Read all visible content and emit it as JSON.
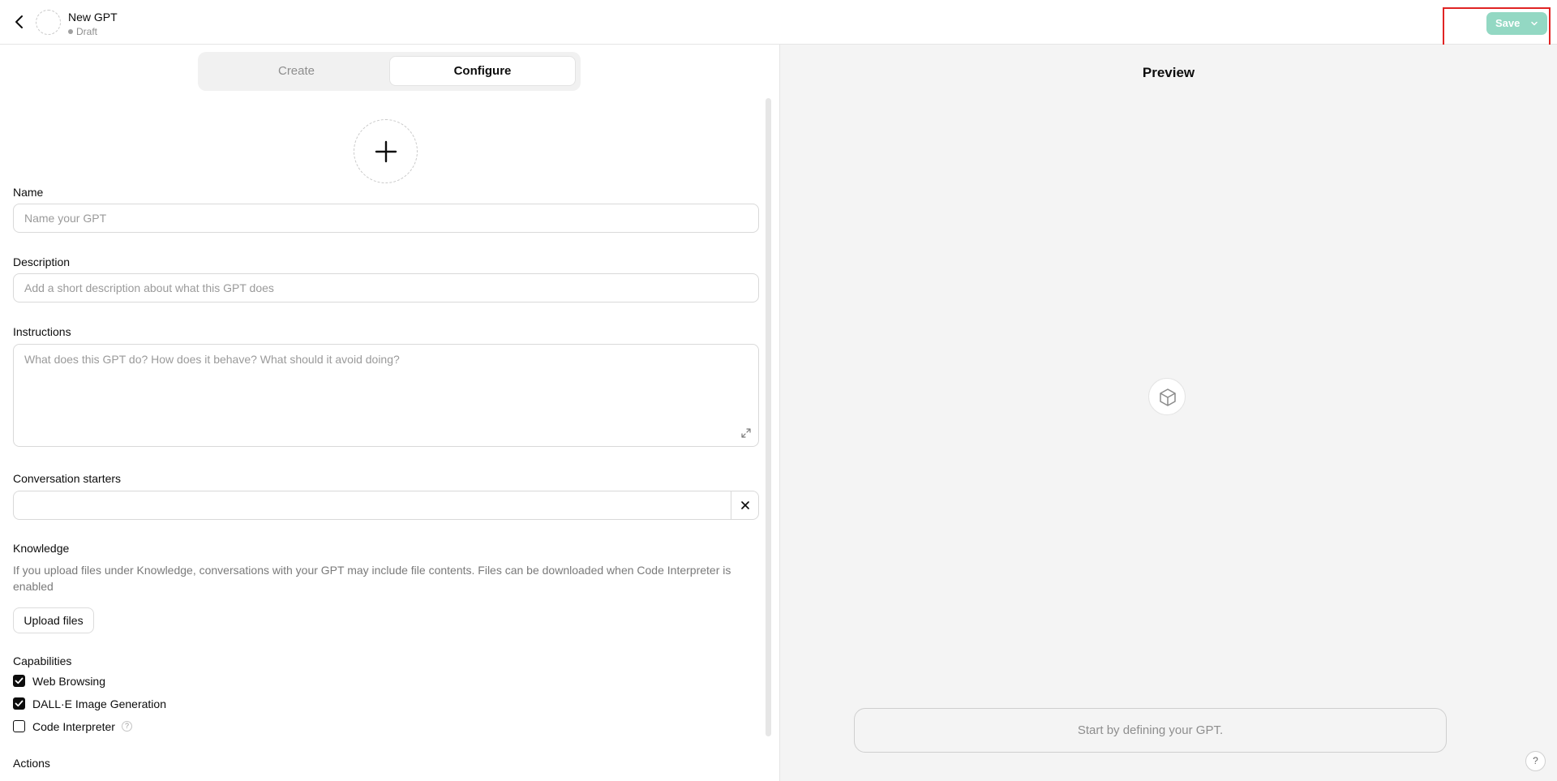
{
  "header": {
    "title": "New GPT",
    "status": "Draft",
    "save_label": "Save"
  },
  "tabs": [
    {
      "label": "Create",
      "active": false
    },
    {
      "label": "Configure",
      "active": true
    }
  ],
  "form": {
    "name": {
      "label": "Name",
      "placeholder": "Name your GPT",
      "value": ""
    },
    "description": {
      "label": "Description",
      "placeholder": "Add a short description about what this GPT does",
      "value": ""
    },
    "instructions": {
      "label": "Instructions",
      "placeholder": "What does this GPT do? How does it behave? What should it avoid doing?",
      "value": ""
    },
    "conversation_starters": {
      "label": "Conversation starters",
      "value": ""
    },
    "knowledge": {
      "label": "Knowledge",
      "description": "If you upload files under Knowledge, conversations with your GPT may include file contents. Files can be downloaded when Code Interpreter is enabled",
      "upload_label": "Upload files"
    },
    "capabilities": {
      "label": "Capabilities",
      "items": [
        {
          "label": "Web Browsing",
          "checked": true
        },
        {
          "label": "DALL·E Image Generation",
          "checked": true
        },
        {
          "label": "Code Interpreter",
          "checked": false
        }
      ],
      "help_glyph": "?"
    },
    "actions": {
      "label": "Actions"
    }
  },
  "preview": {
    "title": "Preview",
    "input_placeholder": "Start by defining your GPT."
  },
  "help_button": "?",
  "colors": {
    "save_button_bg": "#93d8c3",
    "highlight_border": "#e02424",
    "preview_bg": "#f4f4f4"
  },
  "icons": [
    "back-arrow-icon",
    "plus-icon",
    "expand-icon",
    "close-icon",
    "checkmark-icon",
    "cube-icon",
    "chevron-down-icon"
  ]
}
